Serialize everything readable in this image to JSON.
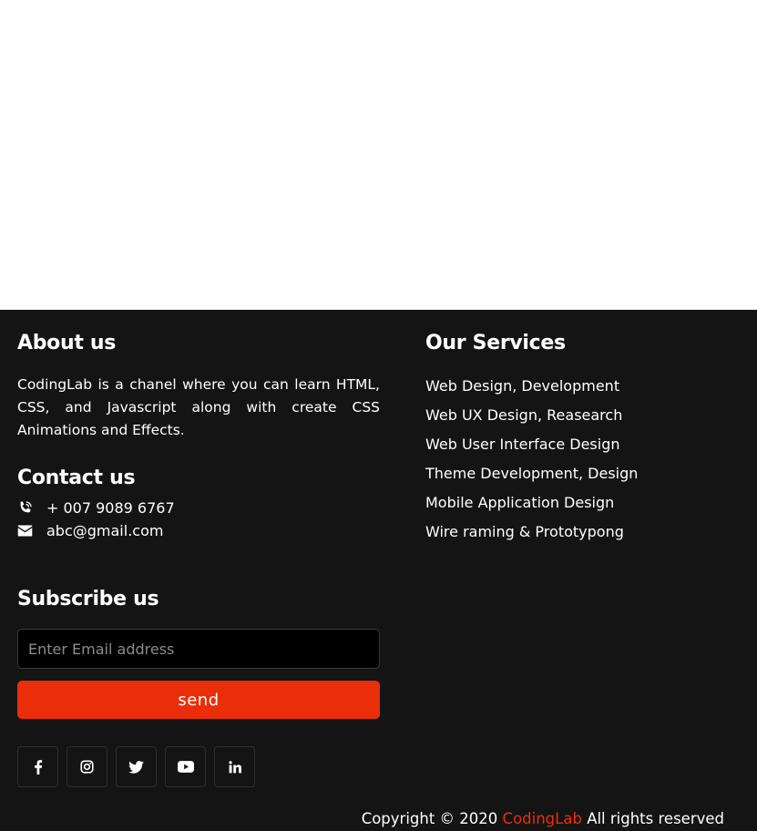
{
  "about": {
    "heading": "About us",
    "text": "CodingLab is a chanel where you can learn HTML, CSS, and Javascript along with create CSS Animations and Effects."
  },
  "contact": {
    "heading": "Contact us",
    "phone": "+ 007 9089 6767",
    "email": "abc@gmail.com",
    "phone_icon": "phone-volume-icon",
    "email_icon": "envelope-icon"
  },
  "subscribe": {
    "heading": "Subscribe us",
    "email_placeholder": "Enter Email address",
    "email_value": "",
    "button_label": "send"
  },
  "socials": [
    {
      "name": "facebook",
      "icon": "facebook-icon"
    },
    {
      "name": "instagram",
      "icon": "instagram-icon"
    },
    {
      "name": "twitter",
      "icon": "twitter-icon"
    },
    {
      "name": "youtube",
      "icon": "youtube-icon"
    },
    {
      "name": "linkedin",
      "icon": "linkedin-icon"
    }
  ],
  "services": {
    "heading": "Our Services",
    "items": [
      "Web Design, Development",
      "Web UX Design, Reasearch",
      "Web User Interface Design",
      "Theme Development, Design",
      "Mobile Application Design",
      "Wire raming & Prototypong"
    ]
  },
  "copyright": {
    "prefix": "Copyright © 2020",
    "brand": "CodingLab",
    "suffix": "All rights reserved"
  },
  "colors": {
    "footer_bg": "#141414",
    "accent": "#ea2e0a",
    "text": "#ffffff"
  }
}
